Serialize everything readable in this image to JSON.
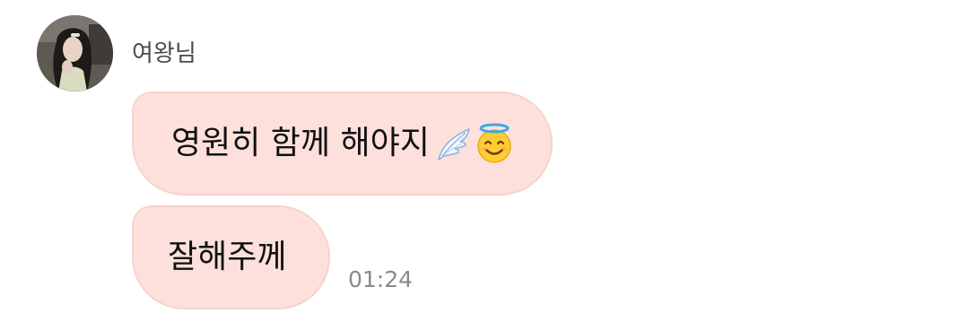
{
  "sender": {
    "name": "여왕님",
    "avatar_icon": "profile-photo"
  },
  "messages": [
    {
      "text": "영원히 함께 해야지",
      "emojis": [
        "wing-icon",
        "smiling-face-with-halo-icon"
      ]
    },
    {
      "text": "잘해주께"
    }
  ],
  "timestamp": "01:24",
  "colors": {
    "bubble_background": "#fde0dc",
    "bubble_border": "#f6d3ce",
    "timestamp": "#8a8a8a",
    "sender_name": "#4a4a4a",
    "page_background": "#ffffff"
  }
}
